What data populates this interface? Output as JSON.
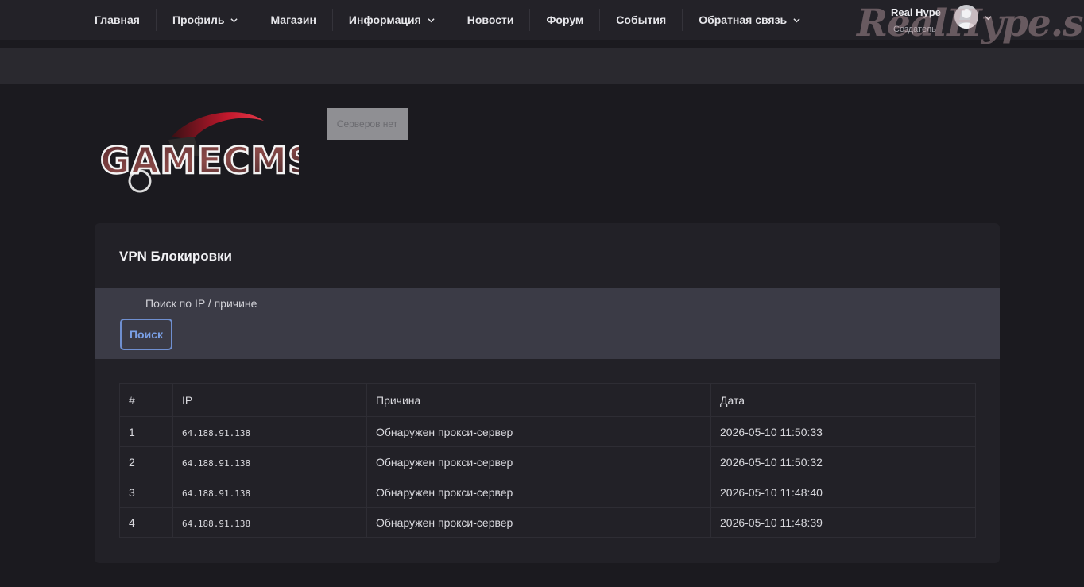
{
  "nav": {
    "items": [
      {
        "label": "Главная",
        "dropdown": false
      },
      {
        "label": "Профиль",
        "dropdown": true
      },
      {
        "label": "Магазин",
        "dropdown": false
      },
      {
        "label": "Информация",
        "dropdown": true
      },
      {
        "label": "Новости",
        "dropdown": false
      },
      {
        "label": "Форум",
        "dropdown": false
      },
      {
        "label": "События",
        "dropdown": false
      },
      {
        "label": "Обратная связь",
        "dropdown": true
      }
    ],
    "user": {
      "name": "Real Hype",
      "role": "Создатель",
      "avatar_icon": "user-avatar-icon"
    }
  },
  "watermark": "RealHype.site",
  "logo_text": "GAMECMS",
  "servers_badge": "Серверов нет",
  "card": {
    "title": "VPN Блокировки",
    "search_placeholder": "Поиск по IP / причине",
    "search_button": "Поиск",
    "columns": [
      "#",
      "IP",
      "Причина",
      "Дата"
    ],
    "rows": [
      {
        "num": "1",
        "ip": "64.188.91.138",
        "reason": "Обнаружен прокси-сервер",
        "date": "2026-05-10 11:50:33"
      },
      {
        "num": "2",
        "ip": "64.188.91.138",
        "reason": "Обнаружен прокси-сервер",
        "date": "2026-05-10 11:50:32"
      },
      {
        "num": "3",
        "ip": "64.188.91.138",
        "reason": "Обнаружен прокси-сервер",
        "date": "2026-05-10 11:48:40"
      },
      {
        "num": "4",
        "ip": "64.188.91.138",
        "reason": "Обнаружен прокси-сервер",
        "date": "2026-05-10 11:48:39"
      }
    ]
  },
  "colors": {
    "background": "#1b1a1f",
    "nav_bg": "#232228",
    "card_bg": "#222127",
    "search_bg": "#3b3b46",
    "accent": "#6f8fd0"
  }
}
